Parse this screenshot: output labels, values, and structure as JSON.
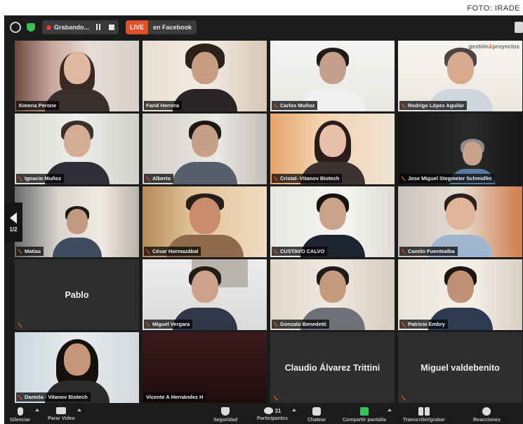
{
  "credit": "FOTO: IRADE",
  "topbar": {
    "recording_label": "Grabando...",
    "live_badge": "LIVE",
    "live_text": "en Facebook"
  },
  "pager": {
    "page": "1/2"
  },
  "brand": {
    "text": "gestión",
    "amp": "&",
    "text2": "proyectos"
  },
  "participants": [
    {
      "name": "Ximena Perone"
    },
    {
      "name": "Farid Herrera"
    },
    {
      "name": "Carlos Muñoz"
    },
    {
      "name": "Rodrigo López Aguilar"
    },
    {
      "name": "Ignacio Muñoz"
    },
    {
      "name": "Alberto"
    },
    {
      "name": "Cristal- Vitanov Biotech"
    },
    {
      "name": "Jose Miguel Stegmeier Schmidlin"
    },
    {
      "name": "Matias"
    },
    {
      "name": "César Hormazábal"
    },
    {
      "name": "CUSTAVO CALVO"
    },
    {
      "name": "Camilo Fuentealba"
    },
    {
      "name": "Pablo"
    },
    {
      "name": "Miguel Vergara"
    },
    {
      "name": "Gonzalo Benedetti"
    },
    {
      "name": "Patricio Embry"
    },
    {
      "name": "Daniela - Vitanov Biotech"
    },
    {
      "name": "Vicente A Hernández H"
    },
    {
      "name": "Claudio Álvarez Trittini"
    },
    {
      "name": "Miguel valdebenito"
    }
  ],
  "toolbar": {
    "mute": "Silenciar",
    "stop_video": "Parar Video",
    "participants_count": "31",
    "security": "Seguridad",
    "participants": "Participantes",
    "chat": "Chatear",
    "share_screen": "Compartir pantalla",
    "transcription": "Transcribir/grabar",
    "reactions": "Reacciones"
  },
  "colors": {
    "window_bg": "#1b1b1b",
    "live_badge": "#e2502b",
    "share_green": "#35c459",
    "muted_icon": "#e45a2a"
  }
}
